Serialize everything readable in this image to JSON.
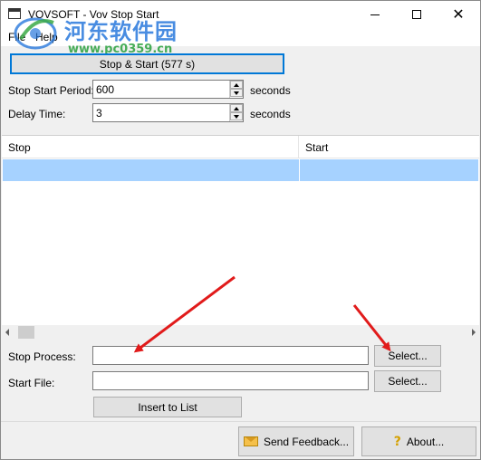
{
  "window": {
    "title": "VOVSOFT - Vov Stop Start"
  },
  "watermark": {
    "site_name": "河东软件园",
    "url": "www.pc0359.cn"
  },
  "menu": {
    "items": [
      {
        "label": "File"
      },
      {
        "label": "Help"
      }
    ]
  },
  "controls": {
    "stop_start_button": "Stop & Start (577 s)",
    "stop_start_period_label": "Stop Start Period:",
    "stop_start_period_value": "600",
    "stop_start_period_unit": "seconds",
    "delay_time_label": "Delay Time:",
    "delay_time_value": "3",
    "delay_time_unit": "seconds"
  },
  "list": {
    "columns": [
      "Stop",
      "Start"
    ],
    "rows": [
      {
        "stop": "",
        "start": "",
        "selected": true
      }
    ]
  },
  "form": {
    "stop_process_label": "Stop Process:",
    "stop_process_value": "",
    "stop_process_select": "Select...",
    "start_file_label": "Start File:",
    "start_file_value": "",
    "start_file_select": "Select...",
    "insert_button": "Insert to List"
  },
  "footer": {
    "send_feedback": "Send Feedback...",
    "about": "About..."
  },
  "colors": {
    "selection": "#a6d2ff",
    "focus_border": "#0078d7",
    "annotation_arrow": "#e11b1b"
  },
  "icons": {
    "send_feedback": "envelope-icon",
    "about": "question-mark-icon"
  }
}
